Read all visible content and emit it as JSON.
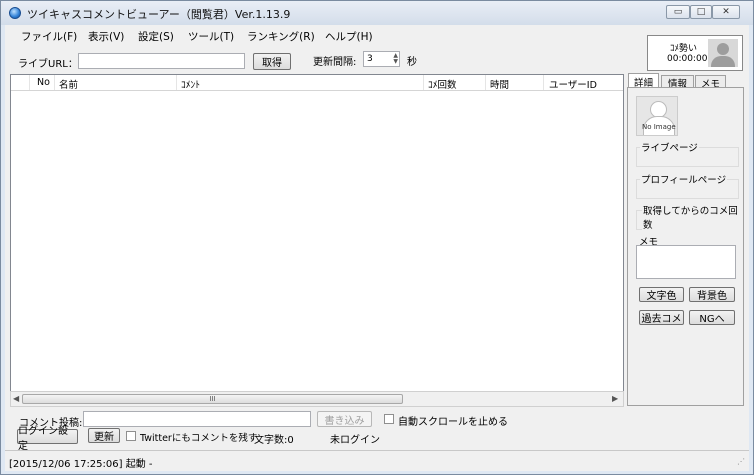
{
  "window": {
    "title": "ツイキャスコメントビューアー（閲覧君）Ver.1.13.9",
    "controls": {
      "minimize": "▭",
      "maximize": "□",
      "close": "✕"
    }
  },
  "menu": [
    "ファイル(F)",
    "表示(V)",
    "設定(S)",
    "ツール(T)",
    "ランキング(R)",
    "ヘルプ(H)"
  ],
  "toolbar": {
    "live_url_label": "ライブURL：",
    "live_url_value": "",
    "fetch_button": "取得",
    "interval_label": "更新間隔:",
    "interval_value": "3",
    "interval_unit": "秒"
  },
  "top_info": {
    "momentum_label": "ｺﾒ勢い",
    "time": "00:00:00"
  },
  "comment_list": {
    "columns": [
      "No",
      "名前",
      "ｺﾒﾝﾄ",
      "ｺﾒ回数",
      "時間",
      "ユーザーID"
    ],
    "rows": [],
    "scroll_thumb": "III"
  },
  "side_panel": {
    "tabs": [
      "詳細",
      "情報",
      "メモ"
    ],
    "no_image": "No Image",
    "live_page": "ライブページ",
    "profile_page": "プロフィールページ",
    "comment_count": "取得してからのコメ回数",
    "memo_label": "メモ",
    "memo_value": "",
    "text_color_button": "文字色",
    "bg_color_button": "背景色",
    "past_comments_button": "過去コメ",
    "ng_button": "NGへ"
  },
  "bottom": {
    "comment_post_label": "コメント投稿:",
    "comment_input": "",
    "write_button": "書き込み",
    "stop_autoscroll": "自動スクロールを止める",
    "login_settings_button": "ログイン設定",
    "refresh_button": "更新",
    "twitter_option": "Twitterにもコメントを残す",
    "char_count": "文字数:0",
    "login_status": "未ログイン"
  },
  "status_bar": {
    "text": "[2015/12/06 17:25:06] 起動 -"
  }
}
